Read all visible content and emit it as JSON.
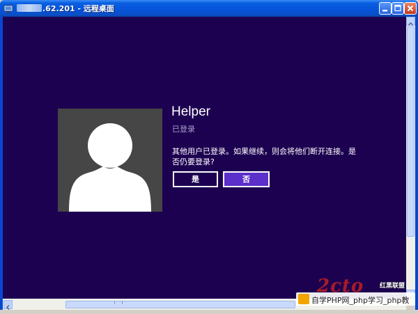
{
  "window": {
    "title_ip": ".62.201",
    "title_separator": " - ",
    "title_app": "远程桌面",
    "controls": [
      "minimize-icon",
      "maximize-icon",
      "close-icon"
    ]
  },
  "login": {
    "username": "Helper",
    "status": "已登录",
    "message": "其他用户已登录。如果继续，则会将他们断开连接。是否仍要登录?",
    "yes_label": "是",
    "no_label": "否"
  },
  "watermark": {
    "logo": "2cto",
    "side_text": "红黑联盟",
    "text": "自学PHP网_php学习_php教"
  },
  "colors": {
    "background": "#1d0151",
    "avatar_bg": "#464646",
    "no_button": "#5b2fc9",
    "titlebar": "#0654da"
  }
}
